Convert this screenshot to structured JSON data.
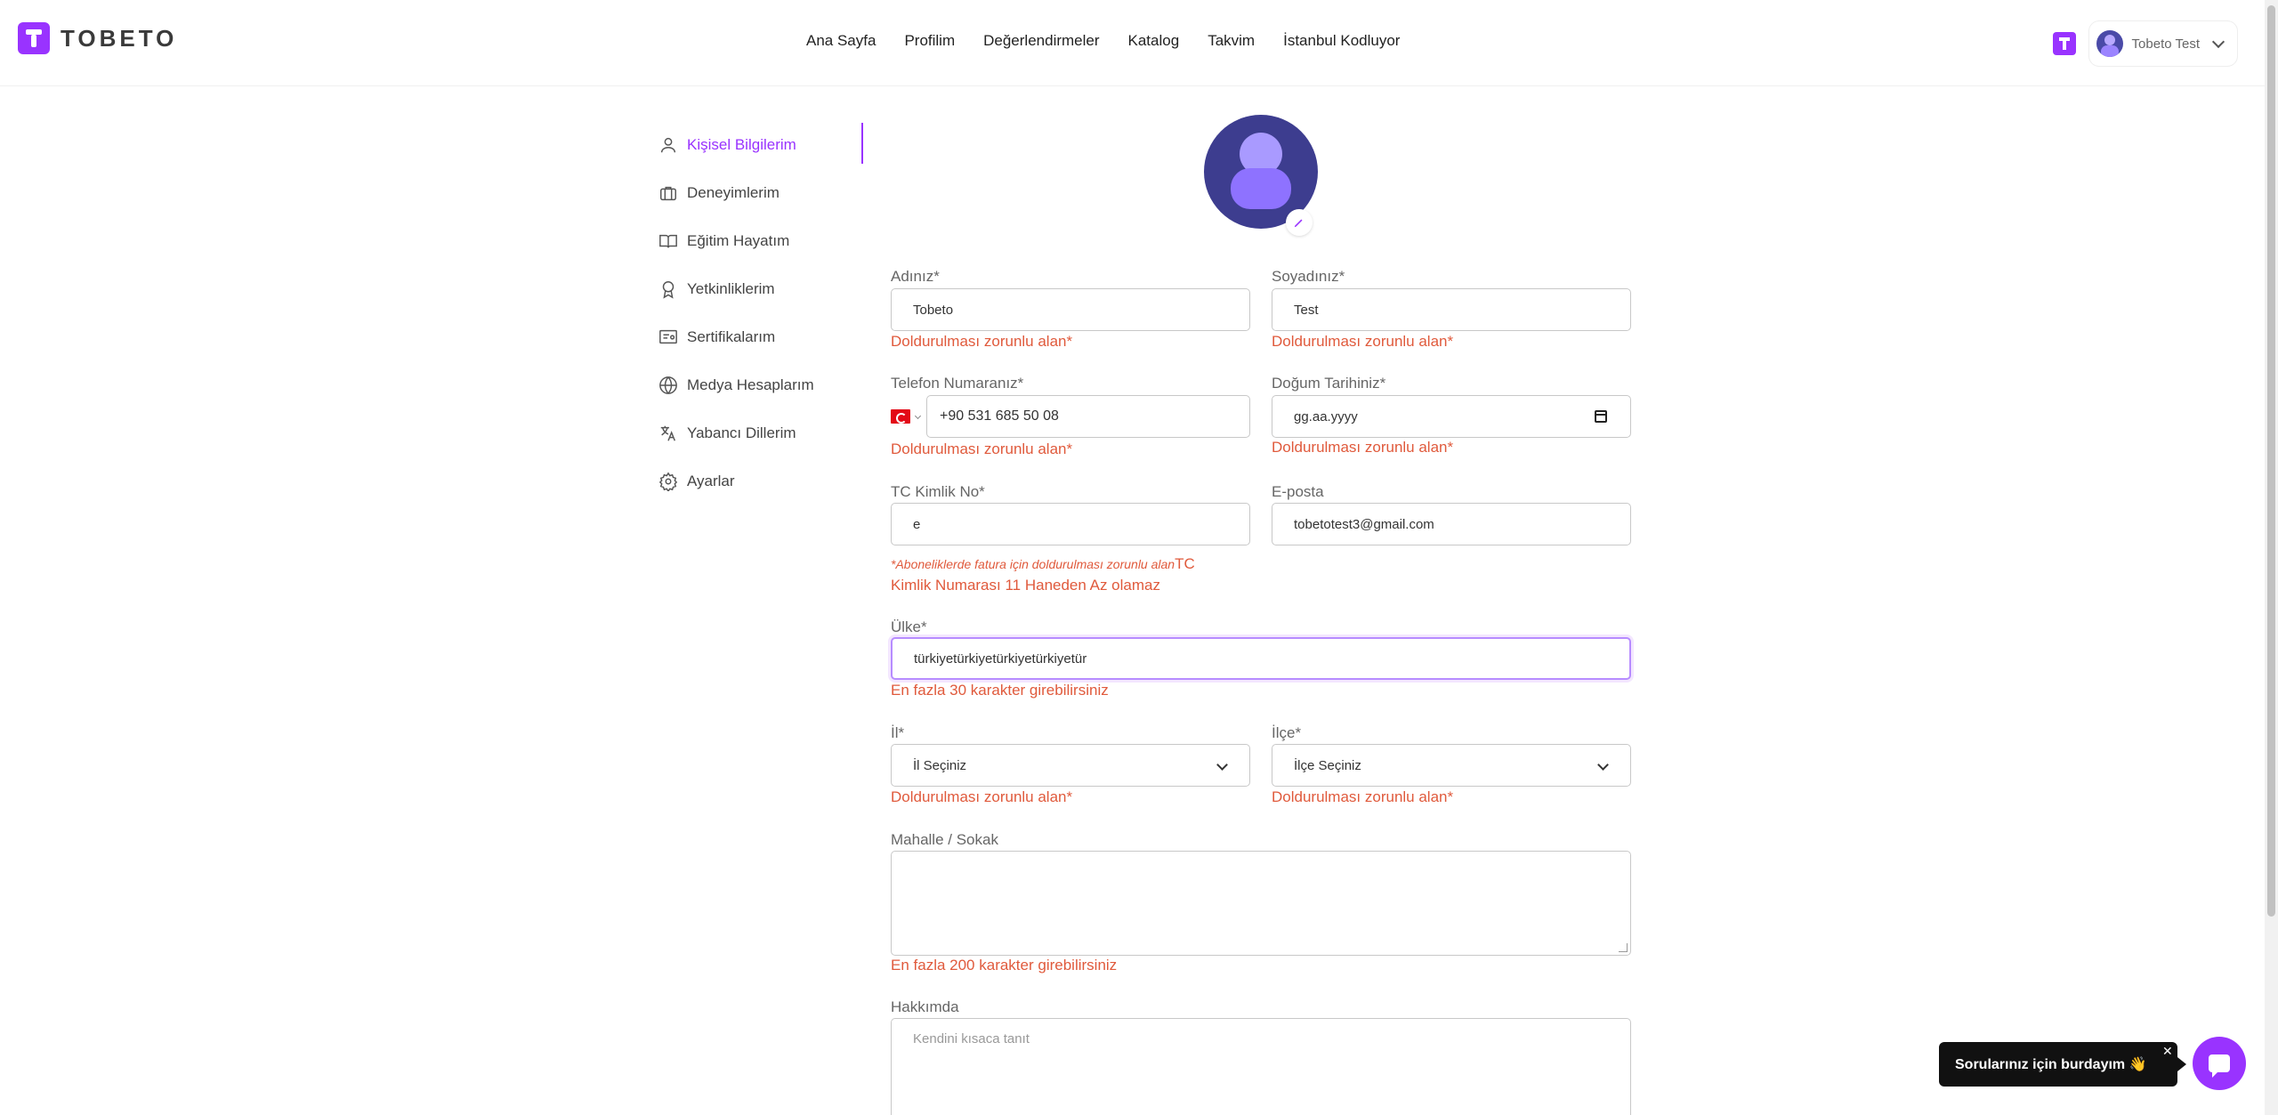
{
  "brand": {
    "logo_text": "TOBETO",
    "accent": "#9933ff",
    "error_color": "#e05a3c"
  },
  "nav": {
    "items": [
      "Ana Sayfa",
      "Profilim",
      "Değerlendirmeler",
      "Katalog",
      "Takvim",
      "İstanbul Kodluyor"
    ]
  },
  "user": {
    "name": "Tobeto Test"
  },
  "sidebar": {
    "items": [
      {
        "label": "Kişisel Bilgilerim",
        "icon": "user-icon",
        "active": true
      },
      {
        "label": "Deneyimlerim",
        "icon": "briefcase-icon"
      },
      {
        "label": "Eğitim Hayatım",
        "icon": "book-icon"
      },
      {
        "label": "Yetkinliklerim",
        "icon": "badge-icon"
      },
      {
        "label": "Sertifikalarım",
        "icon": "certificate-icon"
      },
      {
        "label": "Medya Hesaplarım",
        "icon": "globe-icon"
      },
      {
        "label": "Yabancı Dillerim",
        "icon": "translate-icon"
      },
      {
        "label": "Ayarlar",
        "icon": "gear-icon"
      }
    ]
  },
  "form": {
    "first_name": {
      "label": "Adınız*",
      "value": "Tobeto",
      "error": "Doldurulması zorunlu alan*"
    },
    "last_name": {
      "label": "Soyadınız*",
      "value": "Test",
      "error": "Doldurulması zorunlu alan*"
    },
    "phone": {
      "label": "Telefon Numaranız*",
      "value": "+90 531 685 50 08",
      "error": "Doldurulması zorunlu alan*"
    },
    "birth_date": {
      "label": "Doğum Tarihiniz*",
      "value": "gg.aa.yyyy",
      "error": "Doldurulması zorunlu alan*"
    },
    "tc": {
      "label": "TC Kimlik No*",
      "value": "e",
      "hint": "*Aboneliklerde fatura için doldurulması zorunlu alan",
      "error_part1": "TC",
      "error_part2": "Kimlik Numarası 11 Haneden Az olamaz"
    },
    "email": {
      "label": "E-posta",
      "value": "tobetotest3@gmail.com"
    },
    "country": {
      "label": "Ülke*",
      "value": "türkiyetürkiyetürkiyetürkiyetür",
      "error": "En fazla 30 karakter girebilirsiniz"
    },
    "city": {
      "label": "İl*",
      "value": "İl Seçiniz",
      "error": "Doldurulması zorunlu alan*"
    },
    "district": {
      "label": "İlçe*",
      "value": "İlçe Seçiniz",
      "error": "Doldurulması zorunlu alan*"
    },
    "street": {
      "label": "Mahalle / Sokak",
      "error": "En fazla 200 karakter girebilirsiniz"
    },
    "about": {
      "label": "Hakkımda",
      "placeholder": "Kendini kısaca tanıt"
    }
  },
  "chat": {
    "tooltip": "Sorularınız için burdayım 👋",
    "close": "✕"
  }
}
